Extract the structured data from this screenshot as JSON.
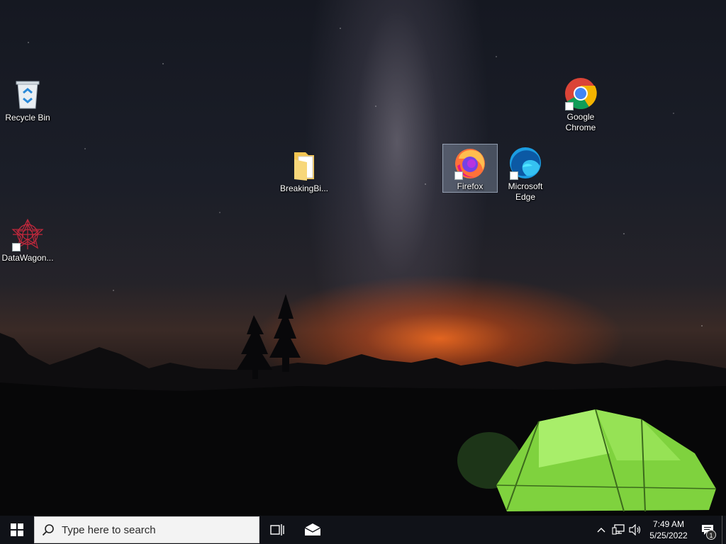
{
  "desktop": {
    "icons": [
      {
        "label": "Recycle Bin",
        "icon": "recycle-bin-icon",
        "shortcut": false,
        "selected": false
      },
      {
        "label": "DataWagon...",
        "icon": "datawagon-icon",
        "shortcut": true,
        "selected": false
      },
      {
        "label": "BreakingBi...",
        "icon": "folder-icon",
        "shortcut": false,
        "selected": false
      },
      {
        "label": "Firefox",
        "icon": "firefox-icon",
        "shortcut": true,
        "selected": true
      },
      {
        "label": "Microsoft Edge",
        "icon": "edge-icon",
        "shortcut": true,
        "selected": false
      },
      {
        "label": "Google Chrome",
        "icon": "chrome-icon",
        "shortcut": true,
        "selected": false
      }
    ]
  },
  "taskbar": {
    "search_placeholder": "Type here to search",
    "clock_time": "7:49 AM",
    "clock_date": "5/25/2022",
    "notification_count": "1"
  },
  "colors": {
    "taskbar_bg": "#101218",
    "selection": "#aabed7",
    "tent_green": "#8fe04a"
  }
}
